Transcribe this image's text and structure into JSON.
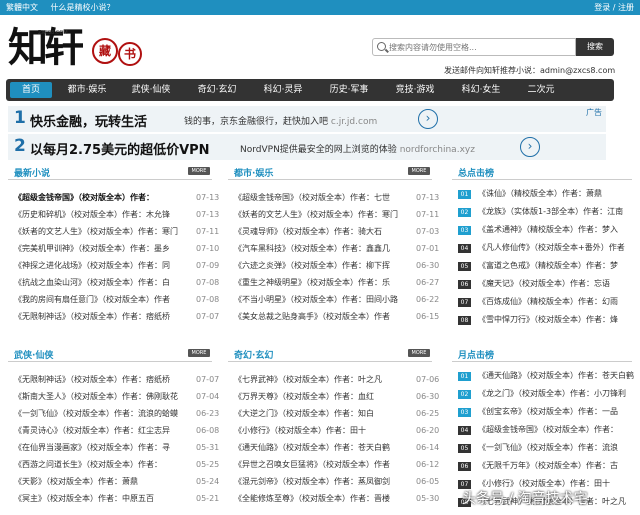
{
  "topbar": {
    "traditional": "繁體中文",
    "whatis": "什么是精校小说？",
    "login": "登录",
    "register": "注册",
    "sep": " / "
  },
  "logo": {
    "text": "知轩",
    "seal1": "藏",
    "seal2": "书",
    "domain": "ZXCS8.COM"
  },
  "search": {
    "placeholder": "搜索内容请勿使用空格...",
    "button": "搜索"
  },
  "mail": "发送邮件向知轩推荐小说：admin@zxcs8.com",
  "nav": [
    "首页",
    "都市·娱乐",
    "武侠·仙侠",
    "奇幻·玄幻",
    "科幻·灵异",
    "历史·军事",
    "竞技·游戏",
    "科幻·女生",
    "二次元"
  ],
  "ads": [
    {
      "num": "1",
      "headline": "快乐金融，玩转生活",
      "sub": "钱的事，京东金融很行，赶快加入吧",
      "url": "c.jr.jd.com",
      "badge": "广告"
    },
    {
      "num": "2",
      "headline": "以每月2.75美元的超低价VPN",
      "sub": "NordVPN提供最安全的网上浏览的体验",
      "url": "nordforchina.xyz",
      "badge": ""
    }
  ],
  "more": "MORE",
  "latest": {
    "title": "最新小说",
    "rows": [
      {
        "t": "《超级金钱帝国》（校对版全本）作者：",
        "d": "07-13"
      },
      {
        "t": "《历史和碎机》（校对版全本）作者：木允锋",
        "d": "07-13"
      },
      {
        "t": "《妖者的文艺人生》（校对版全本）作者：寒门",
        "d": "07-11"
      },
      {
        "t": "《完美机甲训神》（校对版全本）作者：墨乡",
        "d": "07-10"
      },
      {
        "t": "《神探之进化战场》（校对版全本）作者：同",
        "d": "07-09"
      },
      {
        "t": "《抗战之血染山河》（校对版全本）作者：白",
        "d": "07-08"
      },
      {
        "t": "《我的房间有扇任意门》（校对版全本）作者",
        "d": "07-08"
      },
      {
        "t": "《无限制神话》（校对版全本）作者：痞纸桥",
        "d": "07-07"
      }
    ]
  },
  "urban": {
    "title": "都市·娱乐",
    "rows": [
      {
        "t": "《超级金钱帝国》（校对版全本）作者：七世",
        "d": "07-13"
      },
      {
        "t": "《妖者的文艺人生》（校对版全本）作者：寒门",
        "d": "07-11"
      },
      {
        "t": "《灵魂导师》（校对版全本）作者：骑大石",
        "d": "07-03"
      },
      {
        "t": "《汽车黑科技》（校对版全本）作者：鑫鑫几",
        "d": "07-01"
      },
      {
        "t": "《六迹之炎弹》（校对版全本）作者：柳下挥",
        "d": "06-30"
      },
      {
        "t": "《重生之神级明星》（校对版全本）作者：乐",
        "d": "06-27"
      },
      {
        "t": "《不当小明星》（校对版全本）作者：田间小路",
        "d": "06-22"
      },
      {
        "t": "《美女总裁之贴身高手》（校对版全本）作者",
        "d": "06-15"
      }
    ]
  },
  "rank_total": {
    "title": "总点击榜",
    "rows": [
      {
        "n": "01",
        "t": "《诛仙》（精校版全本）作者：萧鼎"
      },
      {
        "n": "02",
        "t": "《龙族》（实体版1-3部全本）作者：江南"
      },
      {
        "n": "03",
        "t": "《盖术通神》（精校版全本）作者：梦入"
      },
      {
        "n": "04",
        "t": "《凡人修仙传》（校对版全本+番外）作者"
      },
      {
        "n": "05",
        "t": "《富道之色戒》（精校版全本）作者：梦"
      },
      {
        "n": "06",
        "t": "《魔天记》（校对版全本）作者：忘语"
      },
      {
        "n": "07",
        "t": "《百炼成仙》（精校版全本）作者：幻雨"
      },
      {
        "n": "08",
        "t": "《雪中悍刀行》（校对版全本）作者：烽"
      }
    ]
  },
  "wuxia": {
    "title": "武侠·仙侠",
    "rows": [
      {
        "t": "《无限制神话》（校对版全本）作者：痞纸桥",
        "d": "07-07"
      },
      {
        "t": "《斯南大圣人》（校对版全本）作者：佛刚耿花",
        "d": "07-04"
      },
      {
        "t": "《一剑飞仙》（校对版全本）作者：流浪的蛤蟆",
        "d": "06-23"
      },
      {
        "t": "《青灵诗心》（校对版全本）作者：红尘志异",
        "d": "06-08"
      },
      {
        "t": "《在仙界当漫画家》（校对版全本）作者：寻",
        "d": "05-31"
      },
      {
        "t": "《西游之问道长生》（校对版全本）作者：",
        "d": "05-25"
      },
      {
        "t": "《天影》（校对版全本）作者：萧鼎",
        "d": "05-24"
      },
      {
        "t": "《冥主》（校对版全本）作者：中原五百",
        "d": "05-21"
      }
    ]
  },
  "fantasy": {
    "title": "奇幻·玄幻",
    "rows": [
      {
        "t": "《七界武神》（校对版全本）作者：叶之凡",
        "d": "07-06"
      },
      {
        "t": "《万界天尊》（校对版全本）作者：血红",
        "d": "06-30"
      },
      {
        "t": "《大逆之门》（校对版全本）作者：知白",
        "d": "06-25"
      },
      {
        "t": "《小修行》（校对版全本）作者：田十",
        "d": "06-20"
      },
      {
        "t": "《通天仙路》（校对版全本）作者：苍天白鹤",
        "d": "06-14"
      },
      {
        "t": "《异世之召唤女巨猛将》（校对版全本）作者",
        "d": "06-12"
      },
      {
        "t": "《混元剑帝》（校对版全本）作者：蒸凤御剑",
        "d": "06-05"
      },
      {
        "t": "《全能修炼至尊》（校对版全本）作者：晋楼",
        "d": "05-30"
      }
    ]
  },
  "rank_month": {
    "title": "月点击榜",
    "rows": [
      {
        "n": "01",
        "t": "《通天仙路》（校对版全本）作者：苍天白鹤"
      },
      {
        "n": "02",
        "t": "《龙之门》（校对版全本）作者：小刀锋利"
      },
      {
        "n": "03",
        "t": "《创宝玄帝》（校对版全本）作者：一品"
      },
      {
        "n": "04",
        "t": "《超级金钱帝国》（校对版全本）作者："
      },
      {
        "n": "05",
        "t": "《一剑飞仙》（校对版全本）作者：流浪"
      },
      {
        "n": "06",
        "t": "《无限千万年》（校对版全本）作者：古"
      },
      {
        "n": "07",
        "t": "《小修行》（校对版全本）作者：田十"
      },
      {
        "n": "08",
        "t": "《七界武神》（校对版全本）作者：叶之凡"
      }
    ]
  },
  "watermark": "头条号 / 淘音技术宅"
}
